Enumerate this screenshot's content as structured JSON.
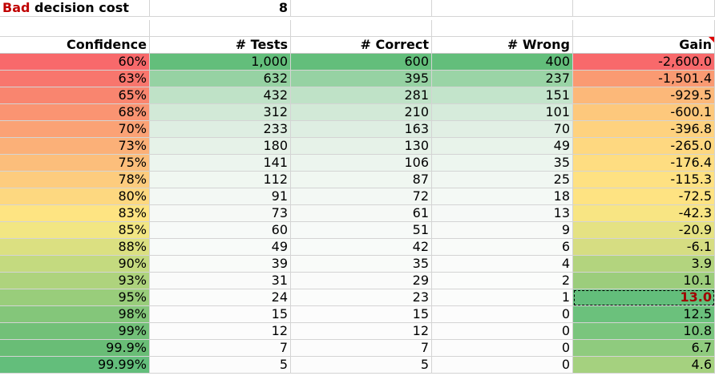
{
  "params": {
    "label_red": "Bad",
    "label_rest": " decision cost",
    "value": "8"
  },
  "headers": [
    "Confidence",
    "# Tests",
    "# Correct",
    "# Wrong",
    "Gain"
  ],
  "rows": [
    [
      "60%",
      "1,000",
      "600",
      "400",
      "-2,600.0"
    ],
    [
      "63%",
      "632",
      "395",
      "237",
      "-1,501.4"
    ],
    [
      "65%",
      "432",
      "281",
      "151",
      "-929.5"
    ],
    [
      "68%",
      "312",
      "210",
      "101",
      "-600.1"
    ],
    [
      "70%",
      "233",
      "163",
      "70",
      "-396.8"
    ],
    [
      "73%",
      "180",
      "130",
      "49",
      "-265.0"
    ],
    [
      "75%",
      "141",
      "106",
      "35",
      "-176.4"
    ],
    [
      "78%",
      "112",
      "87",
      "25",
      "-115.3"
    ],
    [
      "80%",
      "91",
      "72",
      "18",
      "-72.5"
    ],
    [
      "83%",
      "73",
      "61",
      "13",
      "-42.3"
    ],
    [
      "85%",
      "60",
      "51",
      "9",
      "-20.9"
    ],
    [
      "88%",
      "49",
      "42",
      "6",
      "-6.1"
    ],
    [
      "90%",
      "39",
      "35",
      "4",
      "3.9"
    ],
    [
      "93%",
      "31",
      "29",
      "2",
      "10.1"
    ],
    [
      "95%",
      "24",
      "23",
      "1",
      "13.0"
    ],
    [
      "98%",
      "15",
      "15",
      "0",
      "12.5"
    ],
    [
      "99%",
      "12",
      "12",
      "0",
      "10.8"
    ],
    [
      "99.9%",
      "7",
      "7",
      "0",
      "6.7"
    ],
    [
      "99.99%",
      "5",
      "5",
      "0",
      "4.6"
    ]
  ],
  "colors": {
    "confidence": [
      "#f8696b",
      "#f8766d",
      "#f9856f",
      "#fa9472",
      "#fba275",
      "#fbb078",
      "#fcbe7b",
      "#fdcc7e",
      "#fdd880",
      "#fee482",
      "#f2e683",
      "#dbe081",
      "#c4da7f",
      "#aed37d",
      "#99cd7b",
      "#84c67a",
      "#72c078",
      "#69bd76",
      "#63be7b"
    ],
    "tests": [
      "#63be7b",
      "#96d2a3",
      "#bfe2c7",
      "#d2e9d7",
      "#deeee2",
      "#e6f2e8",
      "#ecf5ee",
      "#f0f7f1",
      "#f3f8f4",
      "#f6f9f6",
      "#f7faf8",
      "#f8fbf9",
      "#f9fbf9",
      "#fafbfa",
      "#fbfcfb",
      "#fcfcfc",
      "#fcfcfc",
      "#fcfcfc",
      "#fcfcfc"
    ],
    "correct": [
      "#63be7b",
      "#96d2a3",
      "#bfe2c7",
      "#d2e9d7",
      "#deeee2",
      "#e6f2e8",
      "#ecf5ee",
      "#f0f7f1",
      "#f3f8f4",
      "#f6f9f6",
      "#f7faf8",
      "#f8fbf9",
      "#f9fbf9",
      "#fafbfa",
      "#fbfcfb",
      "#fcfcfc",
      "#fcfcfc",
      "#fcfcfc",
      "#fcfcfc"
    ],
    "wrong": [
      "#63be7b",
      "#9ad4a6",
      "#c3e4cb",
      "#d6ebdb",
      "#e1efe4",
      "#e8f3ea",
      "#edf6ef",
      "#f1f7f2",
      "#f4f9f5",
      "#f6f9f7",
      "#f8faf8",
      "#f9fbf9",
      "#fafbfa",
      "#fbfcfb",
      "#fbfcfb",
      "#fcfcfc",
      "#fcfcfc",
      "#fcfcfc",
      "#fcfcfc"
    ],
    "gain": [
      "#f8696b",
      "#fa9a72",
      "#fcb879",
      "#fdc87c",
      "#fed27f",
      "#fed880",
      "#fedd81",
      "#fee182",
      "#fee382",
      "#f8e583",
      "#e5e283",
      "#d6dd82",
      "#b3d47e",
      "#9ccd7c",
      "#63be7b",
      "#6bc17c",
      "#7ac57d",
      "#8fcb7e",
      "#a5d17f"
    ]
  },
  "selected_row": 14
}
